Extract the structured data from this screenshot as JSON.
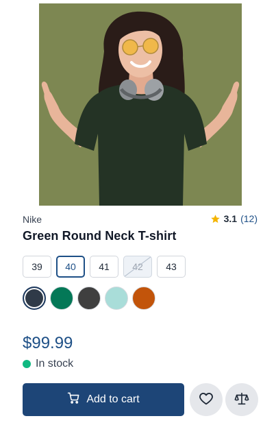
{
  "product": {
    "brand": "Nike",
    "title": "Green Round Neck T-shirt",
    "rating": {
      "value": "3.1",
      "count": "(12)",
      "star_color": "#f4b400"
    },
    "price": "$99.99",
    "stock_status": "In stock",
    "stock_color": "#10b981",
    "image": {
      "icon": "product-photo"
    }
  },
  "sizes": [
    {
      "label": "39",
      "state": "available"
    },
    {
      "label": "40",
      "state": "selected"
    },
    {
      "label": "41",
      "state": "available"
    },
    {
      "label": "42",
      "state": "unavailable"
    },
    {
      "label": "43",
      "state": "available"
    }
  ],
  "colors": [
    {
      "hex": "#2f3a48",
      "selected": true
    },
    {
      "hex": "#047857",
      "selected": false
    },
    {
      "hex": "#3f3f3f",
      "selected": false
    },
    {
      "hex": "#a9ddd9",
      "selected": false
    },
    {
      "hex": "#c2540a",
      "selected": false
    }
  ],
  "actions": {
    "add_to_cart": "Add to cart",
    "add_to_cart_color": "#1d4577",
    "cart_icon": "cart-icon",
    "wishlist_icon": "heart-icon",
    "compare_icon": "scale-icon"
  }
}
